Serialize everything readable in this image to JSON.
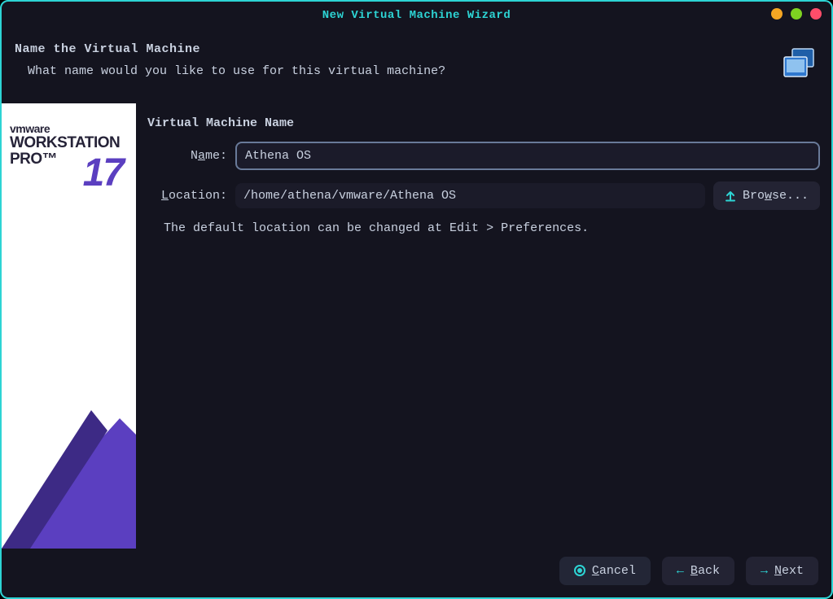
{
  "window": {
    "title": "New Virtual Machine Wizard"
  },
  "header": {
    "title": "Name the Virtual Machine",
    "subtitle": "What name would you like to use for this virtual machine?"
  },
  "logo": {
    "brand": "vmware",
    "product_line1": "WORKSTATION",
    "product_line2": "PRO™",
    "version": "17"
  },
  "form": {
    "section_title": "Virtual Machine Name",
    "name_label": "Name:",
    "name_value": "Athena OS",
    "location_label": "Location:",
    "location_value": "/home/athena/vmware/Athena OS",
    "browse_label": "Browse...",
    "hint": "The default location can be changed at Edit > Preferences."
  },
  "footer": {
    "cancel": "Cancel",
    "back": "Back",
    "next": "Next"
  }
}
